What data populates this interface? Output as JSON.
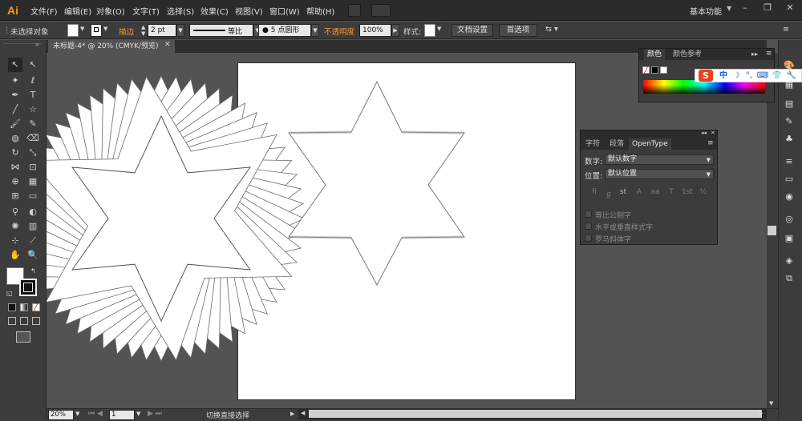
{
  "app": {
    "logo": "Ai",
    "workspace": "基本功能"
  },
  "menu": [
    "文件(F)",
    "编辑(E)",
    "对象(O)",
    "文字(T)",
    "选择(S)",
    "效果(C)",
    "视图(V)",
    "窗口(W)",
    "帮助(H)"
  ],
  "window_buttons": {
    "minimize": "–",
    "restore": "❐",
    "close": "✕"
  },
  "control_bar": {
    "selection_status": "未选择对象",
    "stroke_label": "描边",
    "stroke_weight": "2 pt",
    "stroke_profile": "等比",
    "brush": "5 点圆形",
    "opacity_label": "不透明度",
    "opacity_value": "100%",
    "style_label": "样式:",
    "doc_setup_button": "文档设置",
    "preferences_button": "首选项"
  },
  "document_tab": {
    "title": "未标题-4* @ 20% (CMYK/预览)",
    "close": "✕"
  },
  "status_bar": {
    "zoom": "20%",
    "page": "1",
    "tool_status": "切换直接选择"
  },
  "color_panel": {
    "tabs": [
      "颜色",
      "颜色参考"
    ],
    "active_tab": 0
  },
  "ime_bar": {
    "logo": "S",
    "mode": "中",
    "icons": [
      "☽",
      "°,",
      "⌨",
      "👕",
      "🔧"
    ]
  },
  "char_panel": {
    "tabs": [
      "字符",
      "段落",
      "OpenType"
    ],
    "active_tab": 2,
    "numbers_label": "数字:",
    "numbers_value": "默认数字",
    "position_label": "位置:",
    "position_value": "默认位置",
    "glyphs": [
      "fi",
      "ℊ",
      "st",
      "A",
      "aa",
      "T",
      "1st",
      "½"
    ],
    "checkboxes": [
      "等比公制字",
      "水平或垂直样式字",
      "罗马斜体字"
    ]
  },
  "colors": {
    "accent_orange": "#f29a2e",
    "ai_logo": "#ff9a00",
    "panel_bg": "#3c3c3c",
    "canvas_bg": "#535353"
  }
}
